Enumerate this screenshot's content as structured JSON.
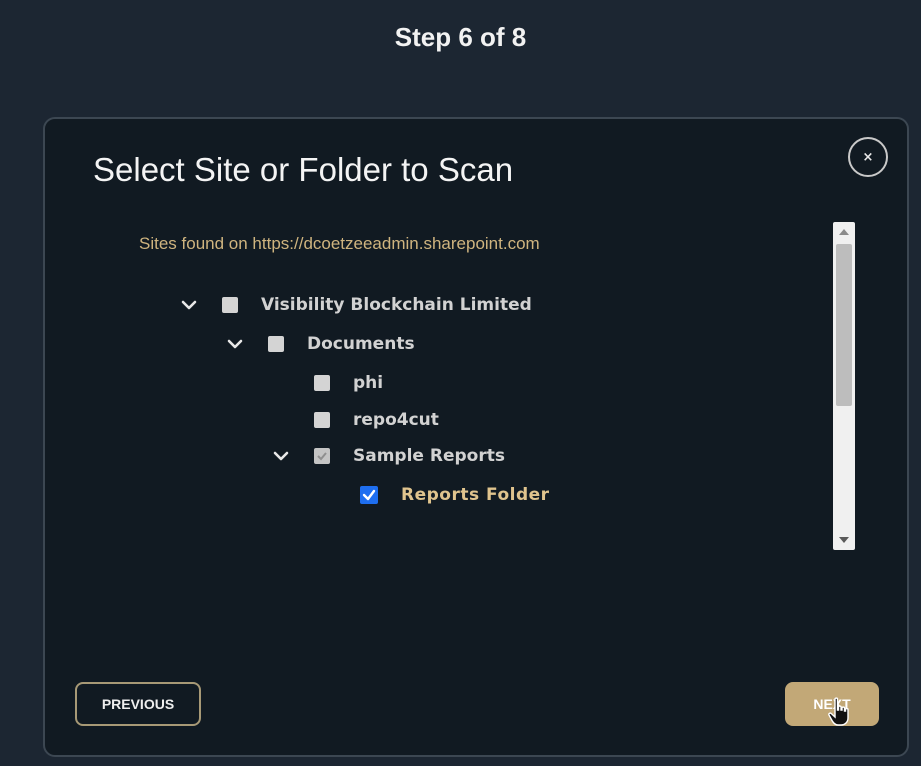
{
  "header": {
    "step_title": "Step 6 of  8"
  },
  "modal": {
    "title": "Select Site or Folder to Scan",
    "close_label": "×",
    "sites_found_text": "Sites found on https://dcoetzeeadmin.sharepoint.com",
    "tree": [
      {
        "label": "Visibility Blockchain Limited",
        "level": 0,
        "expanded": true,
        "state": "unchecked"
      },
      {
        "label": "Documents",
        "level": 1,
        "expanded": true,
        "state": "unchecked"
      },
      {
        "label": "phi",
        "level": 2,
        "expanded": null,
        "state": "unchecked"
      },
      {
        "label": "repo4cut",
        "level": 2,
        "expanded": null,
        "state": "unchecked"
      },
      {
        "label": "Sample Reports",
        "level": 2,
        "expanded": true,
        "state": "partial"
      },
      {
        "label": "Reports Folder",
        "level": 3,
        "expanded": null,
        "state": "checked"
      }
    ],
    "previous_label": "PREVIOUS",
    "next_label": "NEXT"
  },
  "colors": {
    "accent_gold": "#c2a877",
    "checkbox_blue": "#1e6ef0",
    "background": "#1c2632",
    "panel": "#111a22"
  },
  "icons": {
    "expand": "chevron-down-icon",
    "close": "close-icon",
    "cursor": "hand-pointer-icon"
  }
}
